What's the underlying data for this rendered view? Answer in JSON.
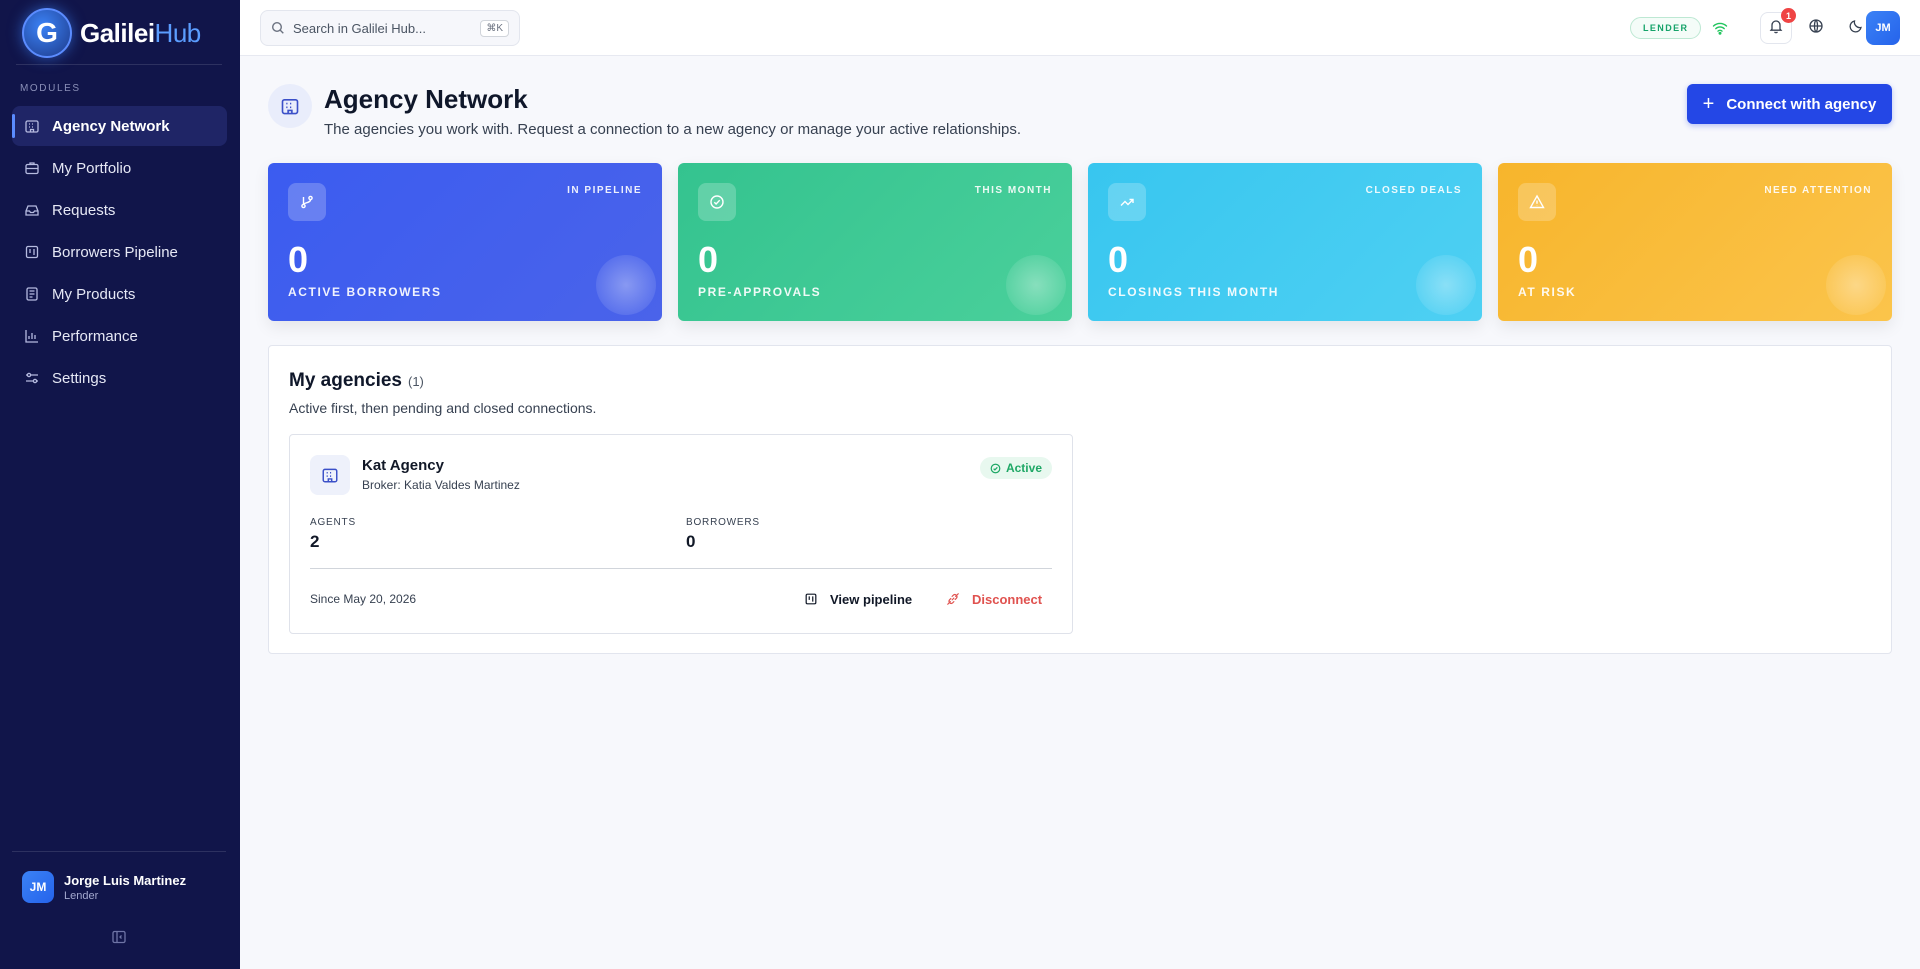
{
  "app": {
    "logo_letter": "G",
    "logo_main": "Galilei",
    "logo_accent": "Hub"
  },
  "sidebar": {
    "section_label": "MODULES",
    "items": [
      {
        "label": "Agency Network",
        "icon": "building-icon",
        "active": true
      },
      {
        "label": "My Portfolio",
        "icon": "briefcase-icon"
      },
      {
        "label": "Requests",
        "icon": "inbox-icon"
      },
      {
        "label": "Borrowers Pipeline",
        "icon": "kanban-icon"
      },
      {
        "label": "My Products",
        "icon": "product-icon"
      },
      {
        "label": "Performance",
        "icon": "bar-chart-icon"
      },
      {
        "label": "Settings",
        "icon": "sliders-icon"
      }
    ],
    "user": {
      "initials": "JM",
      "name": "Jorge Luis Martinez",
      "role": "Lender"
    }
  },
  "topbar": {
    "search_placeholder": "Search in Galilei Hub...",
    "search_shortcut": "⌘K",
    "role_badge": "LENDER",
    "notifications_count": "1",
    "avatar_initials": "JM"
  },
  "page": {
    "title": "Agency Network",
    "subtitle": "The agencies you work with. Request a connection to a new agency or manage your active relationships.",
    "connect_button": "Connect with agency"
  },
  "stats": [
    {
      "tag": "IN PIPELINE",
      "value": "0",
      "label": "ACTIVE BORROWERS",
      "color": "#3b5cf0"
    },
    {
      "tag": "THIS MONTH",
      "value": "0",
      "label": "PRE-APPROVALS",
      "color": "#34c38f"
    },
    {
      "tag": "CLOSED DEALS",
      "value": "0",
      "label": "CLOSINGS THIS MONTH",
      "color": "#38c6ef"
    },
    {
      "tag": "NEED ATTENTION",
      "value": "0",
      "label": "AT RISK",
      "color": "#f7b52c"
    }
  ],
  "agencies": {
    "title": "My agencies",
    "count": "(1)",
    "subtitle": "Active first, then pending and closed connections.",
    "items": [
      {
        "name": "Kat Agency",
        "broker": "Broker: Katia Valdes Martinez",
        "status": "Active",
        "agents_label": "AGENTS",
        "agents": "2",
        "borrowers_label": "BORROWERS",
        "borrowers": "0",
        "since": "Since May 20, 2026",
        "view_label": "View pipeline",
        "disconnect_label": "Disconnect"
      }
    ]
  }
}
